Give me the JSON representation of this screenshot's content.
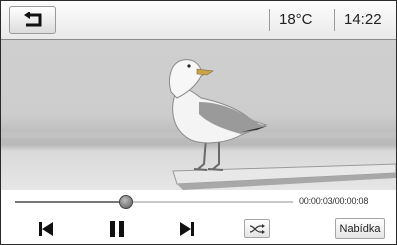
{
  "header": {
    "back_icon": "return-arrow-icon",
    "temperature": "18°C",
    "time": "14:22"
  },
  "video": {
    "subject": "seagull standing on a railing"
  },
  "playback": {
    "elapsed_total": "00:00:03/00:00:08",
    "progress_fraction": 0.4
  },
  "controls": {
    "previous_icon": "skip-previous-icon",
    "pause_icon": "pause-icon",
    "next_icon": "skip-next-icon",
    "shuffle_icon": "shuffle-icon",
    "menu_label": "Nabídka"
  },
  "colors": {
    "accent": "#222222",
    "track": "#c8c8c8"
  }
}
